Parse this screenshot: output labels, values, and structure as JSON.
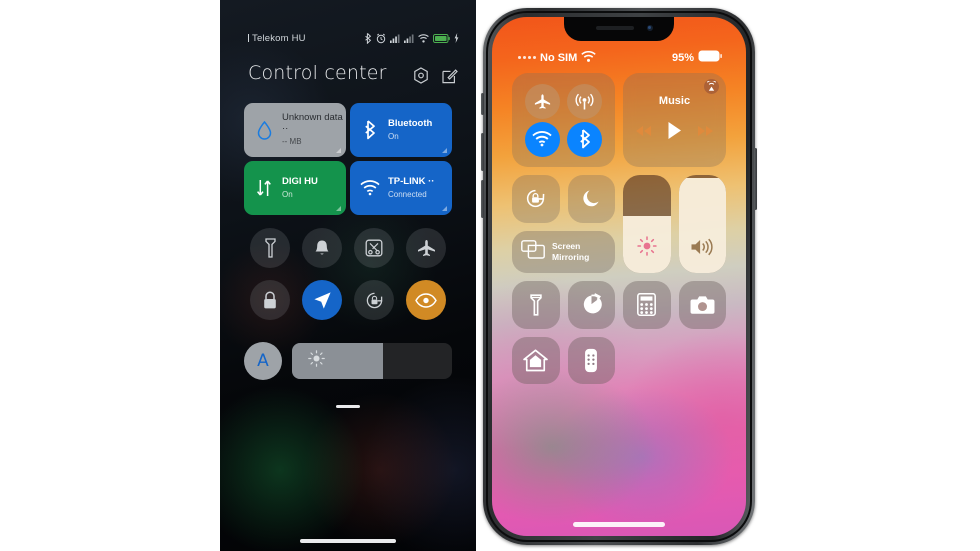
{
  "android": {
    "status_bar": {
      "carrier": "Telekom HU",
      "icons": [
        "bluetooth-icon",
        "alarm-icon",
        "signal-icon",
        "signal-icon-2",
        "wifi-icon",
        "battery-icon",
        "charging-icon"
      ]
    },
    "header": {
      "title": "Control center",
      "settings_icon": "hex-gear-icon",
      "edit_icon": "edit-pencil-icon"
    },
    "tiles": [
      {
        "name": "mobile-data",
        "icon": "water-drop-icon",
        "label": "Unknown data ··",
        "sub": "-- MB",
        "style": "grey"
      },
      {
        "name": "bluetooth",
        "icon": "bluetooth-icon",
        "label": "Bluetooth",
        "sub": "On",
        "style": "blue"
      },
      {
        "name": "mobile-network",
        "icon": "data-arrows-icon",
        "label": "DIGI HU",
        "sub": "On",
        "style": "green"
      },
      {
        "name": "wifi",
        "icon": "wifi-icon",
        "label": "TP-LINK ··",
        "sub": "Connected",
        "style": "blue"
      }
    ],
    "toggles": [
      {
        "name": "flashlight",
        "icon": "flashlight-icon",
        "state": "off"
      },
      {
        "name": "sound",
        "icon": "bell-icon",
        "state": "off"
      },
      {
        "name": "screenshot",
        "icon": "scissors-icon",
        "state": "off"
      },
      {
        "name": "airplane-mode",
        "icon": "airplane-icon",
        "state": "off"
      },
      {
        "name": "screen-lock",
        "icon": "lock-icon",
        "state": "off"
      },
      {
        "name": "location",
        "icon": "location-arrow-icon",
        "state": "on-blue"
      },
      {
        "name": "auto-rotate",
        "icon": "rotate-lock-icon",
        "state": "off"
      },
      {
        "name": "reading-mode",
        "icon": "eye-icon",
        "state": "on-orange"
      }
    ],
    "brightness": {
      "auto_label": "A",
      "icon": "sun-icon",
      "value_percent": 57
    }
  },
  "iphone": {
    "status_bar": {
      "carrier": "No SIM",
      "wifi_icon": "wifi-icon",
      "battery_percent": "95%",
      "battery_icon": "battery-icon"
    },
    "connectivity": [
      {
        "name": "airplane-mode",
        "icon": "airplane-icon",
        "state": "off"
      },
      {
        "name": "cellular-data",
        "icon": "cellular-antenna-icon",
        "state": "off"
      },
      {
        "name": "wifi",
        "icon": "wifi-icon",
        "state": "on"
      },
      {
        "name": "bluetooth",
        "icon": "bluetooth-icon",
        "state": "on"
      }
    ],
    "music": {
      "title": "Music",
      "airplay_icon": "airplay-icon",
      "rewind_icon": "rewind-icon",
      "play_icon": "play-icon",
      "forward_icon": "fast-forward-icon"
    },
    "quick_toggles": [
      {
        "name": "rotation-lock",
        "icon": "rotation-lock-icon"
      },
      {
        "name": "do-not-disturb",
        "icon": "moon-icon"
      }
    ],
    "screen_mirroring": {
      "label_line1": "Screen",
      "label_line2": "Mirroring",
      "icon": "screen-mirroring-icon"
    },
    "brightness_slider": {
      "icon": "sun-icon",
      "value_percent": 58
    },
    "volume_slider": {
      "icon": "speaker-icon",
      "value_percent": 97
    },
    "shortcuts": [
      {
        "name": "flashlight",
        "icon": "flashlight-icon"
      },
      {
        "name": "timer",
        "icon": "timer-icon"
      },
      {
        "name": "calculator",
        "icon": "calculator-icon"
      },
      {
        "name": "camera",
        "icon": "camera-icon"
      },
      {
        "name": "home",
        "icon": "home-icon"
      },
      {
        "name": "apple-tv-remote",
        "icon": "remote-icon"
      }
    ]
  },
  "colors": {
    "android_blue": "#1565c8",
    "android_green": "#14934c",
    "android_grey": "#9ea3a8",
    "android_orange": "#d18a24",
    "ios_blue": "#0a84ff"
  }
}
